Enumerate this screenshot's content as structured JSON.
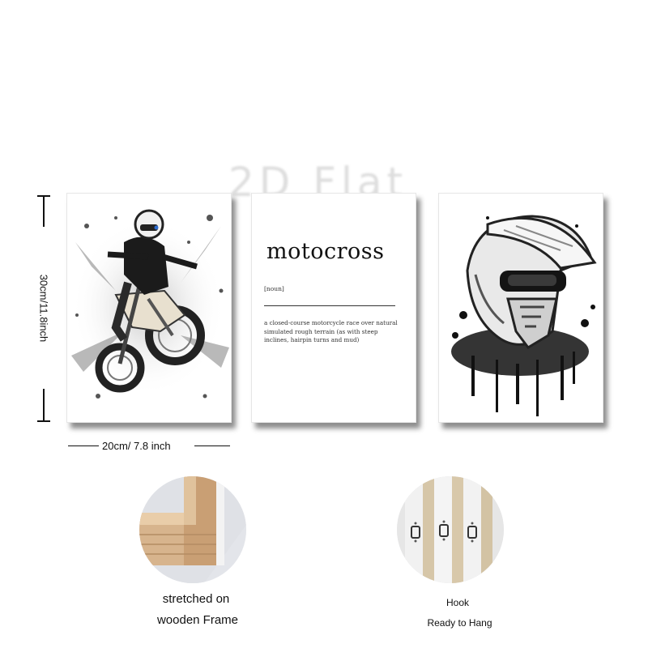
{
  "watermark": "2D Flat",
  "panels": {
    "motorcycle": {
      "icon": "motocross-rider-icon"
    },
    "definition": {
      "word": "motocross",
      "part_of_speech": "[noun]",
      "text": "a closed-course motorcycle race over natural simulated rough terrain (as with steep inclines, hairpin turns and mud)"
    },
    "helmet": {
      "icon": "motocross-helmet-icon"
    }
  },
  "dimensions": {
    "height_label": "30cm/11.8inch",
    "width_label": "20cm/ 7.8 inch"
  },
  "features": {
    "frame": {
      "line1": "stretched on",
      "line2": "wooden Frame"
    },
    "hook": {
      "line1": "Hook",
      "line2": "Ready to Hang"
    }
  }
}
